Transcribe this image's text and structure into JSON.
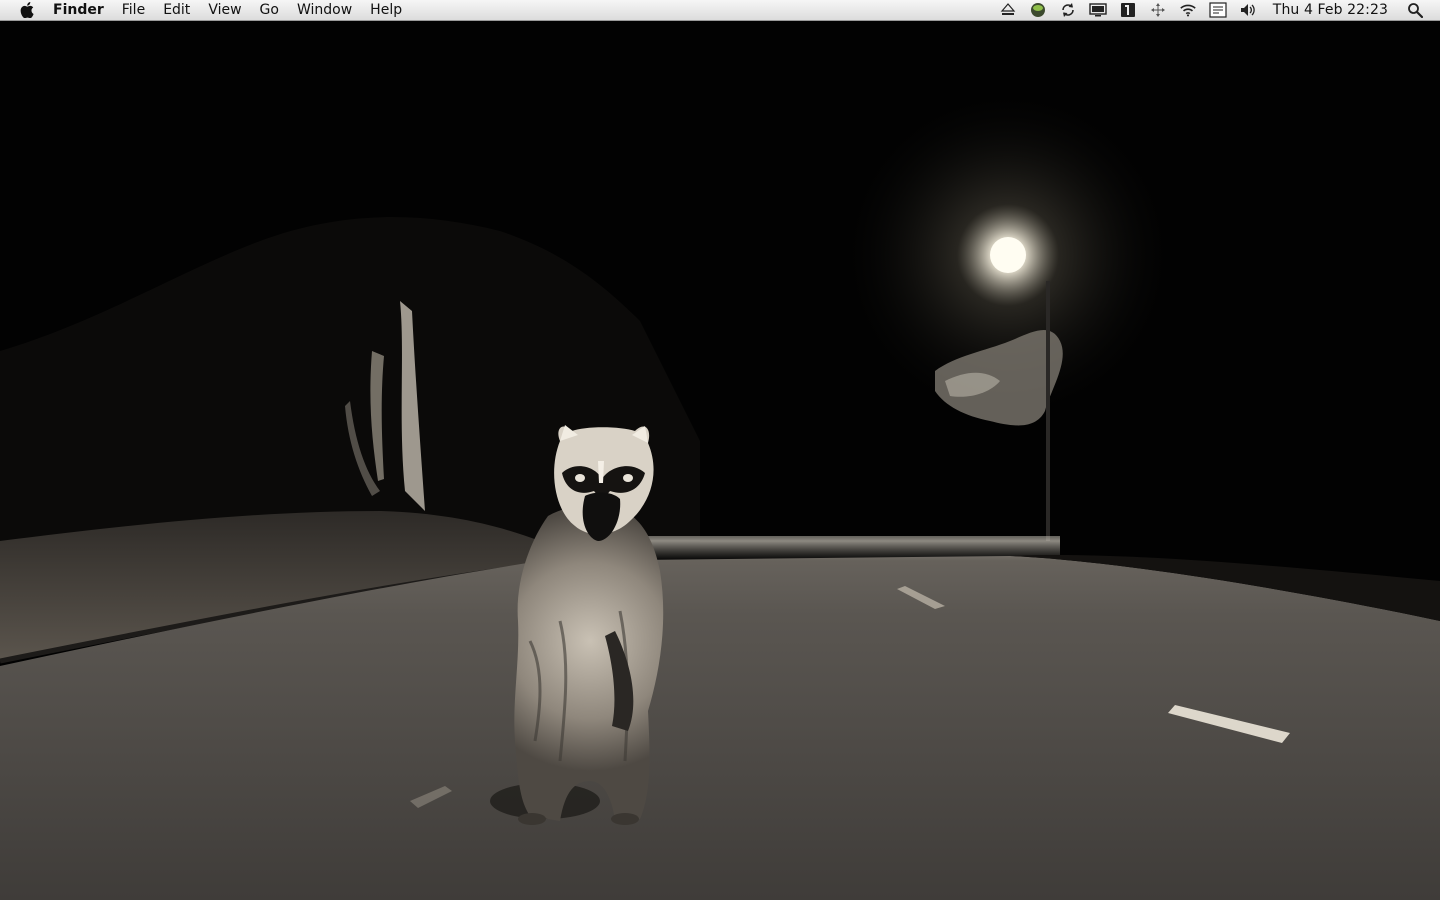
{
  "menubar": {
    "apple_icon": "apple-logo-icon",
    "app_name": "Finder",
    "menus": [
      "File",
      "Edit",
      "View",
      "Go",
      "Window",
      "Help"
    ],
    "status_icons": [
      "eject-icon",
      "green-orb-icon",
      "sync-icon",
      "display-icon",
      "one-password-icon",
      "arrows-move-icon",
      "wifi-icon",
      "keyboard-input-icon",
      "volume-icon"
    ],
    "clock": "Thu 4 Feb  22:23",
    "spotlight_icon": "spotlight-search-icon"
  },
  "desktop": {
    "wallpaper": "night road with raccoon standing under street lamp"
  }
}
